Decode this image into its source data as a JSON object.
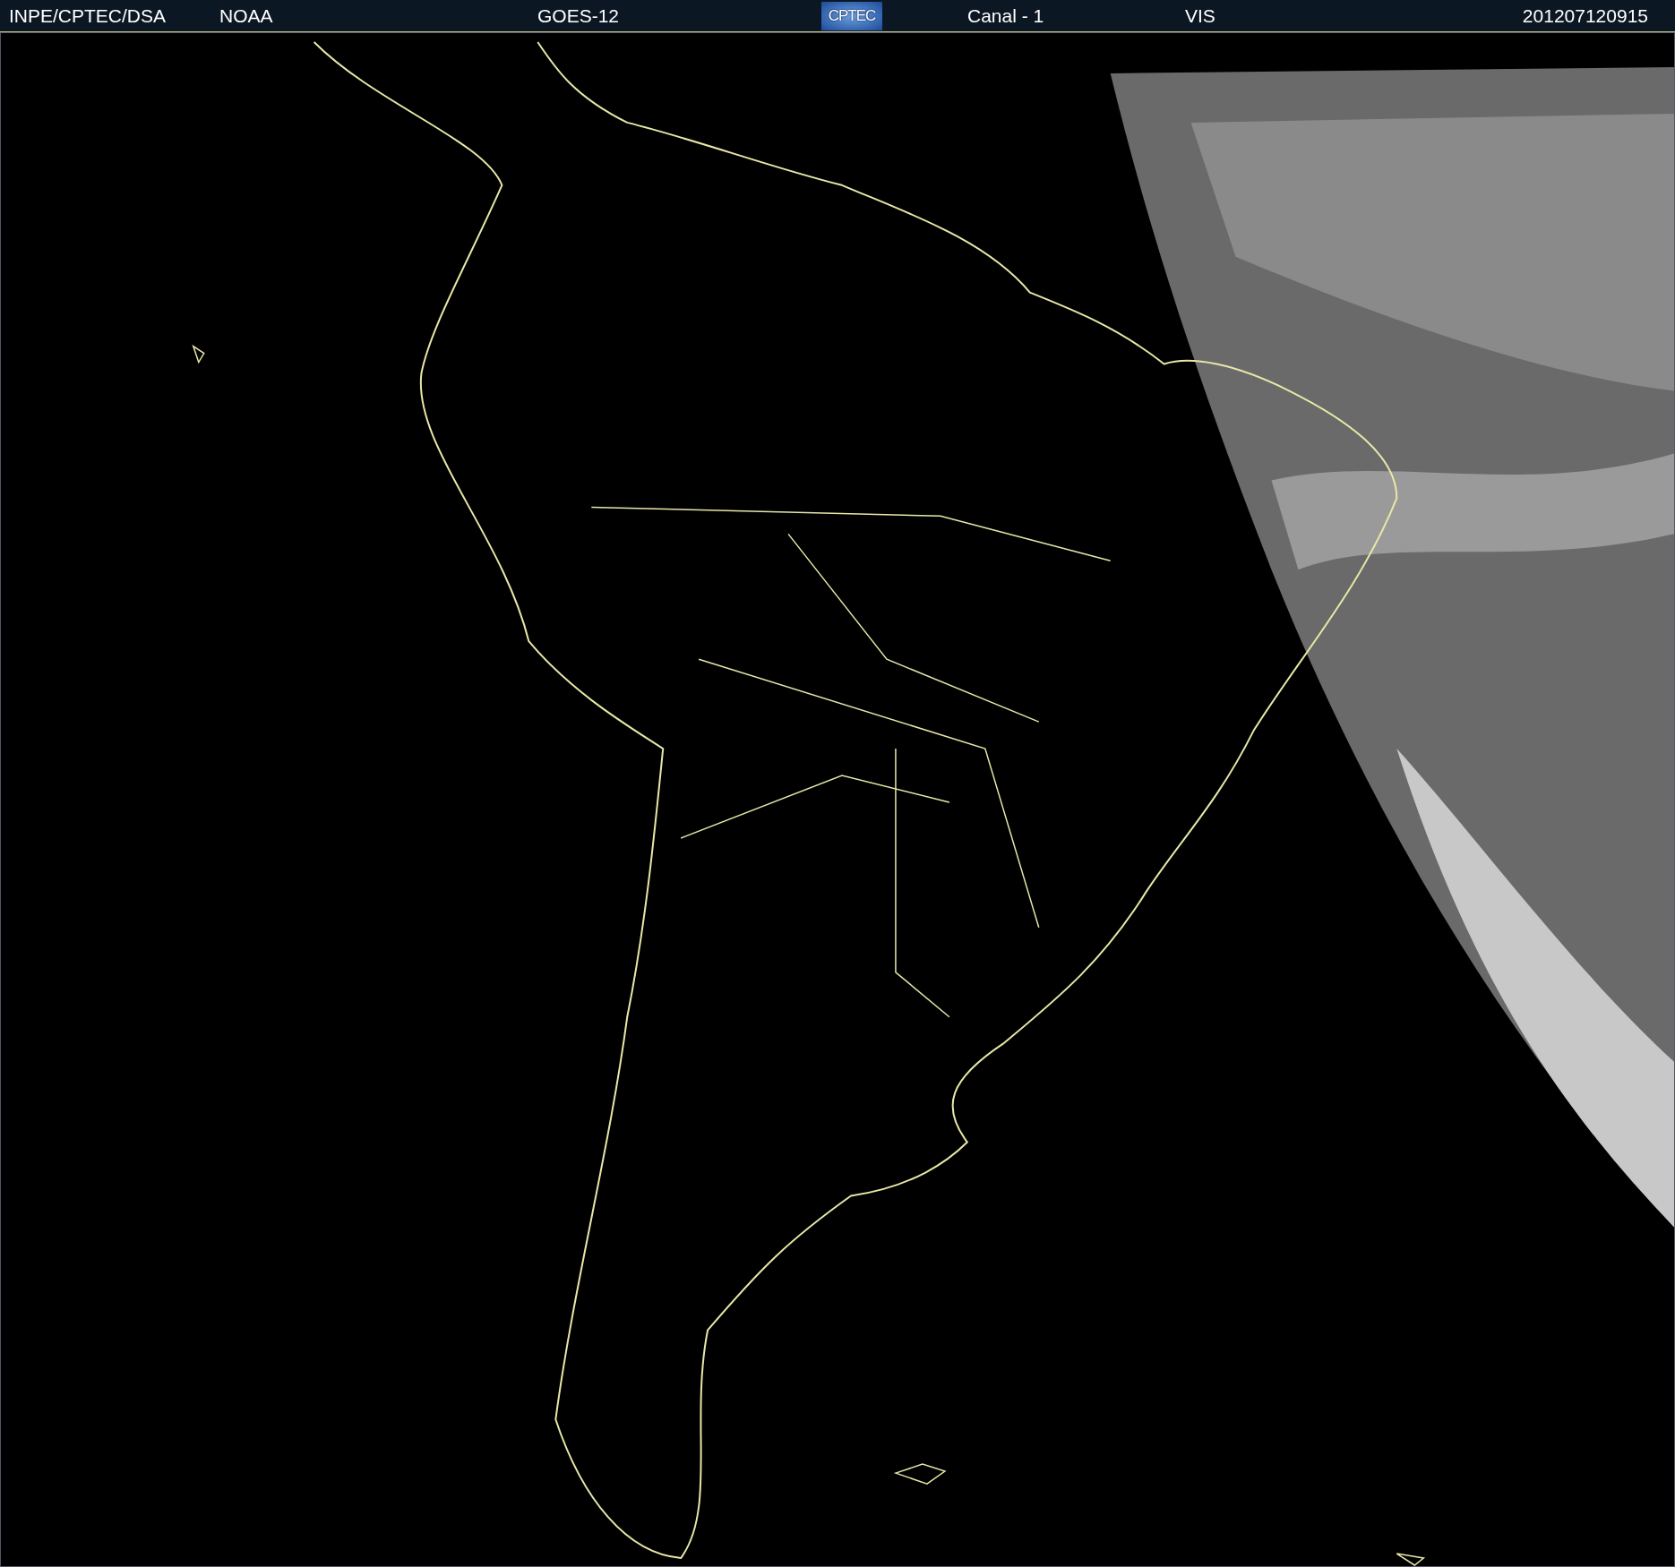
{
  "header": {
    "items": [
      {
        "kind": "text",
        "text": "INPE/CPTEC/DSA"
      },
      {
        "kind": "text",
        "text": "NOAA"
      },
      {
        "kind": "text",
        "text": "GOES-12"
      },
      {
        "kind": "logo",
        "text": "CPTEC"
      },
      {
        "kind": "text",
        "text": "Canal - 1"
      },
      {
        "kind": "text",
        "text": "VIS"
      },
      {
        "kind": "date",
        "text": "201207120915"
      }
    ]
  }
}
